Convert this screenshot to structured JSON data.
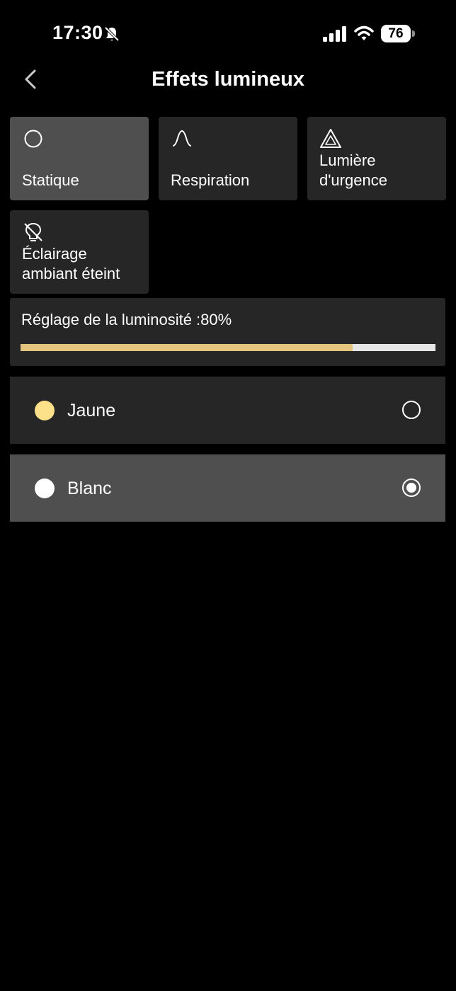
{
  "status_bar": {
    "time": "17:30",
    "battery": "76",
    "icons": [
      "bell-off-icon",
      "cellular-signal-icon",
      "wifi-icon",
      "battery-icon"
    ]
  },
  "nav": {
    "back_icon": "chevron-left-icon",
    "title": "Effets lumineux"
  },
  "effects": [
    {
      "label": "Statique",
      "icon": "circle-icon",
      "selected": true
    },
    {
      "label": "Respiration",
      "icon": "wave-icon",
      "selected": false
    },
    {
      "label": "Lumière d'urgence",
      "icon": "warning-triangle-icon",
      "selected": false
    },
    {
      "label": "Éclairage ambiant éteint",
      "icon": "bulb-off-icon",
      "selected": false
    }
  ],
  "brightness": {
    "label": "Réglage de la luminosité :80%",
    "value": 0.8,
    "fill_color": "#E4C47E",
    "track_color": "#E6E6E6"
  },
  "colors": [
    {
      "label": "Jaune",
      "swatch": "#FDE08A",
      "selected": false
    },
    {
      "label": "Blanc",
      "swatch": "#FFFFFF",
      "selected": true
    }
  ],
  "theme": {
    "background": "#000000",
    "card": "#262626",
    "card_selected": "#4F4F4F"
  }
}
